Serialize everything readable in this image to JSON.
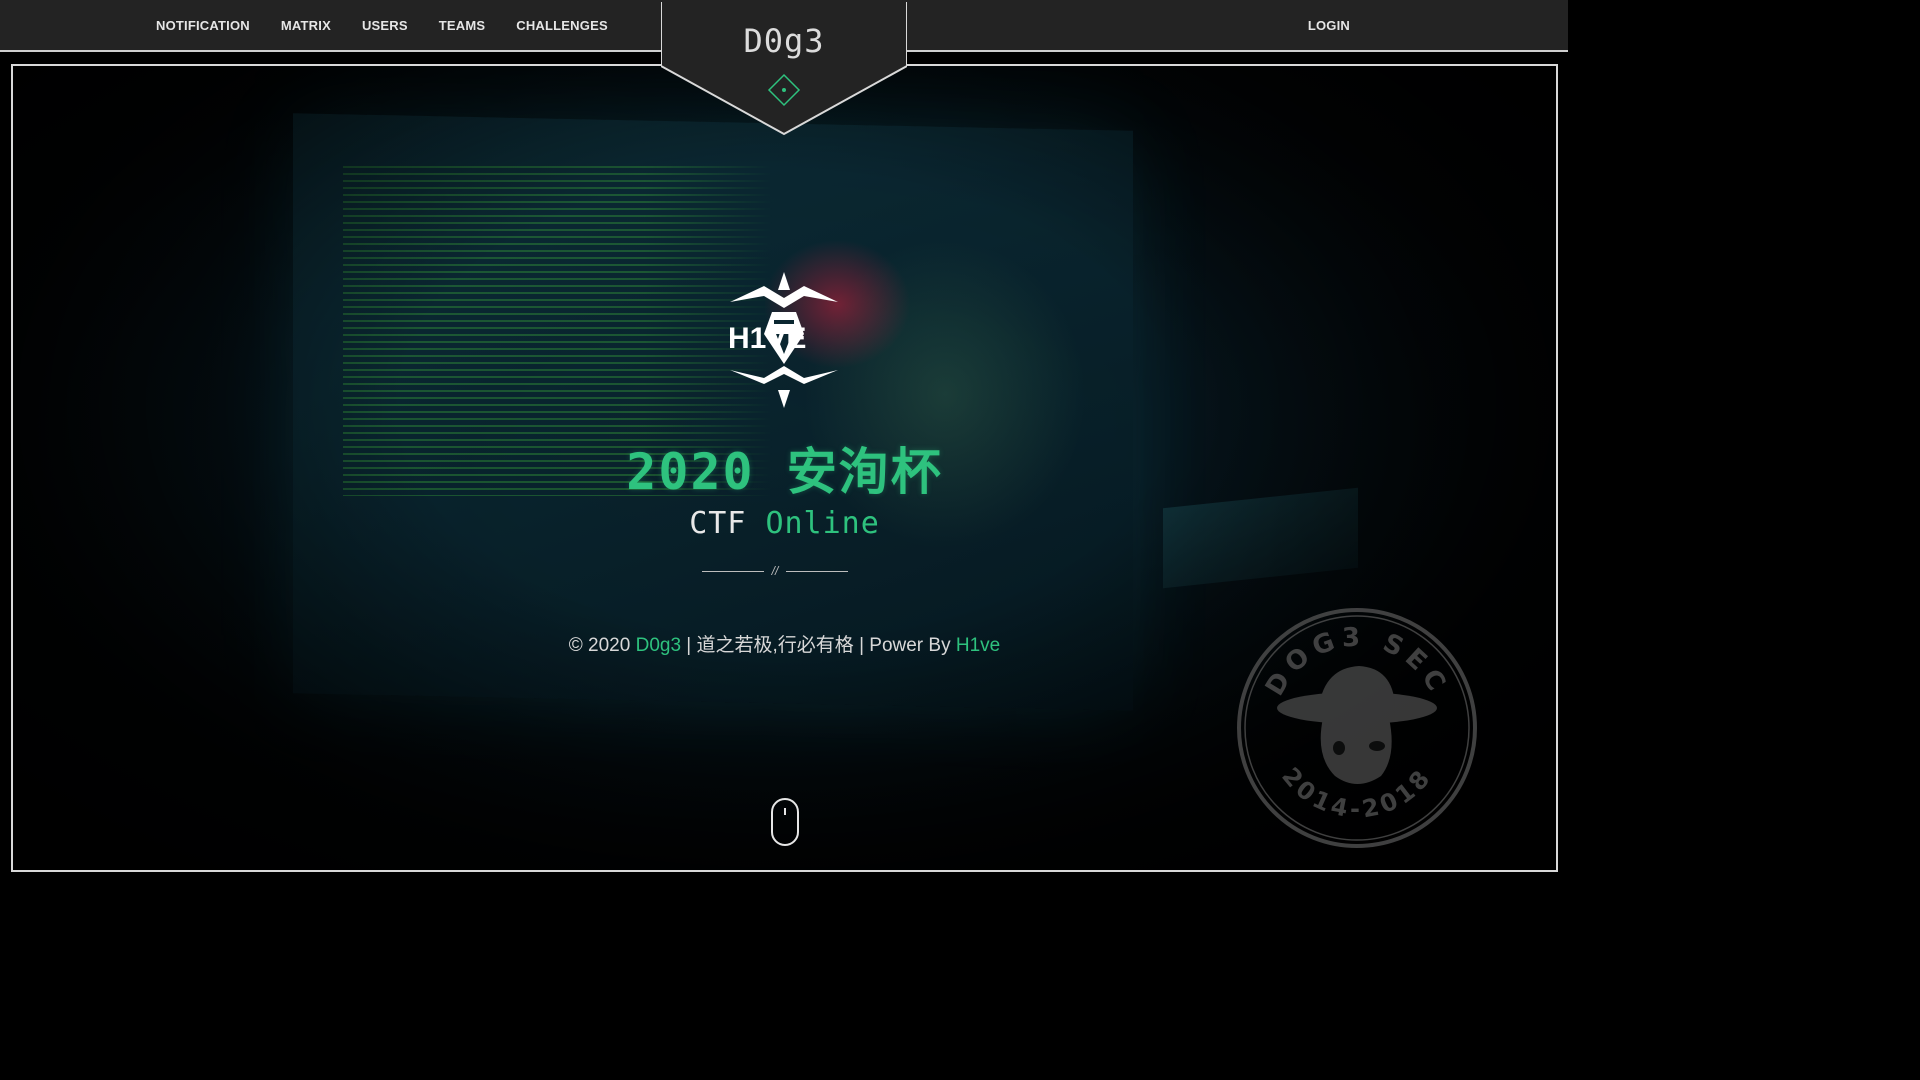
{
  "nav": {
    "left": [
      {
        "label": "NOTIFICATION"
      },
      {
        "label": "MATRIX"
      },
      {
        "label": "USERS"
      },
      {
        "label": "TEAMS"
      },
      {
        "label": "CHALLENGES"
      }
    ],
    "login": "LOGIN",
    "brand": "D0g3"
  },
  "hero": {
    "logo_text": "H1VE",
    "title": "2020 安洵杯",
    "subtitle_white": "CTF ",
    "subtitle_green": "Online",
    "divider_mark": "//"
  },
  "footer": {
    "copyright": "© 2020 ",
    "brand": "D0g3",
    "motto": " | 道之若极,行必有格 | Power By ",
    "power": "H1ve"
  },
  "seal": {
    "top_text": "DOG3 SEC",
    "bottom_text": "2014-2018"
  },
  "colors": {
    "accent": "#2ec27e",
    "nav_bg": "#232323",
    "frame_border": "#d9d9d9"
  }
}
